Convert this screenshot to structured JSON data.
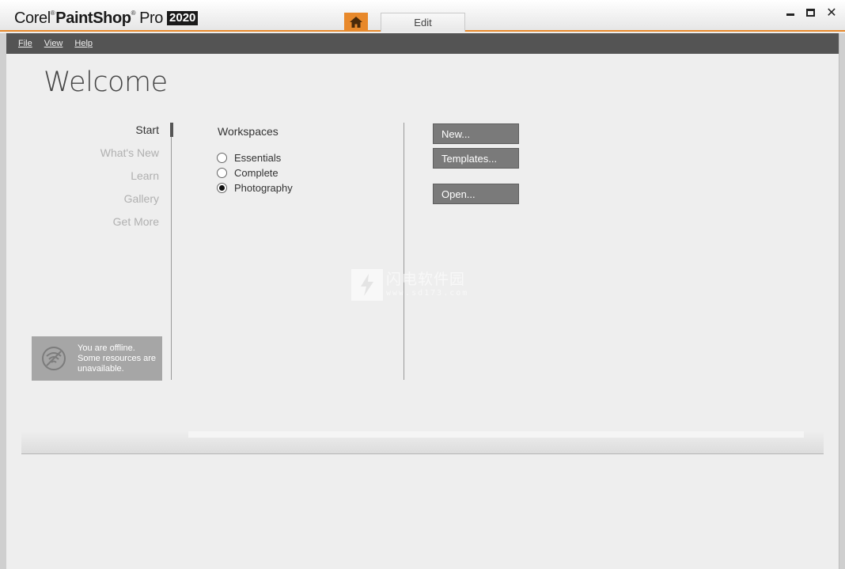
{
  "app": {
    "brand_corel": "Corel",
    "brand_paintshop": "PaintShop",
    "brand_pro": "Pro",
    "brand_year": "2020",
    "accent_color": "#e8892b"
  },
  "tabs": {
    "home_icon": "home-icon",
    "edit_label": "Edit"
  },
  "window_controls": [
    "minimize-icon",
    "maximize-icon",
    "close-icon"
  ],
  "menu": {
    "file": "File",
    "view": "View",
    "help": "Help"
  },
  "page": {
    "title": "Welcome"
  },
  "nav": {
    "items": [
      {
        "label": "Start"
      },
      {
        "label": "What's New"
      },
      {
        "label": "Learn"
      },
      {
        "label": "Gallery"
      },
      {
        "label": "Get More"
      }
    ],
    "active": "Start"
  },
  "offline": {
    "line1": "You are offline.",
    "line2": "Some resources are",
    "line3": "unavailable.",
    "icon": "no-wifi-icon"
  },
  "workspaces": {
    "title": "Workspaces",
    "options": [
      {
        "label": "Essentials",
        "selected": false
      },
      {
        "label": "Complete",
        "selected": false
      },
      {
        "label": "Photography",
        "selected": true
      }
    ]
  },
  "actions": {
    "new": "New...",
    "templates": "Templates...",
    "open": "Open..."
  },
  "watermark": {
    "cn": "闪电软件园",
    "url": "www.sd173.com"
  }
}
